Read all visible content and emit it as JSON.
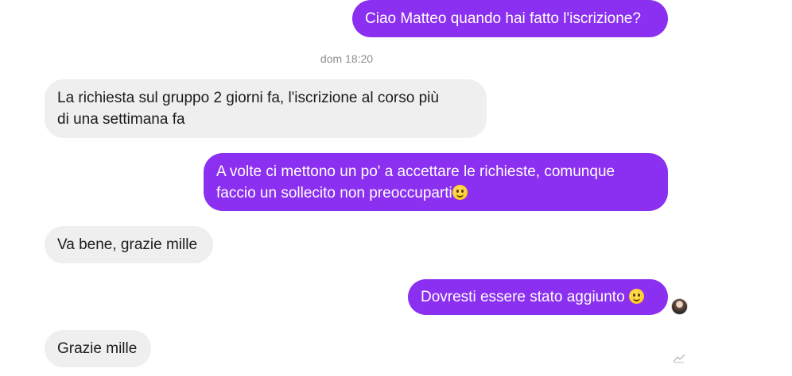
{
  "conversation": {
    "timestamp": "dom 18:20",
    "messages": [
      {
        "direction": "sent",
        "text": "Ciao Matteo quando hai fatto l'iscrizione?"
      },
      {
        "direction": "received",
        "line1": "La richiesta sul gruppo 2 giorni fa, l'iscrizione al corso più",
        "line2": "di una settimana fa"
      },
      {
        "direction": "sent",
        "line1": "A volte ci mettono un po' a accettare le richieste, comunque",
        "line2": "faccio un sollecito non preoccuparti",
        "emoji": "slightly-smiling-face"
      },
      {
        "direction": "received",
        "text": "Va bene, grazie mille"
      },
      {
        "direction": "sent",
        "text": "Dovresti essere stato aggiunto ",
        "emoji": "smiling-face-with-smiling-eyes"
      },
      {
        "direction": "received",
        "text": "Grazie mille"
      }
    ],
    "colors": {
      "sent_bubble": "#8b2ff0",
      "received_bubble": "#efefef",
      "timestamp_text": "#8e8e8e"
    },
    "icons": [
      "avatar",
      "seen-icon"
    ]
  }
}
